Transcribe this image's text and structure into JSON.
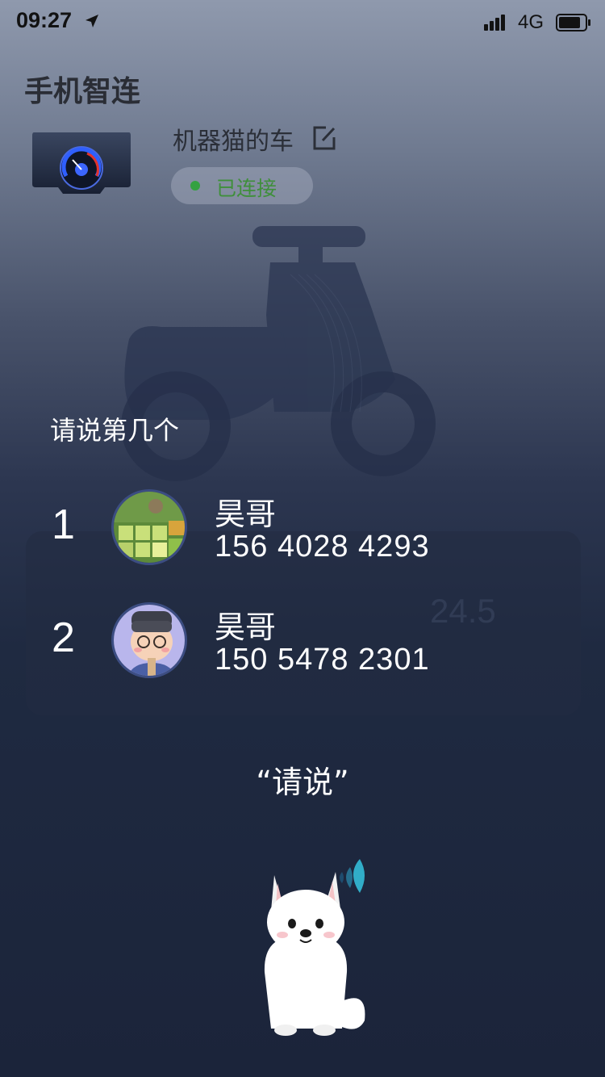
{
  "status_bar": {
    "time": "09:27",
    "network": "4G",
    "icons": [
      "location-arrow-icon",
      "signal-icon",
      "battery-icon"
    ]
  },
  "header": {
    "title": "手机智连"
  },
  "vehicle": {
    "name": "机器猫的车",
    "status": "已连接",
    "status_color": "#34a141",
    "icons": [
      "dashboard-thumbnail",
      "edit-icon"
    ]
  },
  "background_card": {
    "value": "24.5"
  },
  "prompt": "请说第几个",
  "contacts": [
    {
      "index": "1",
      "name": "昊哥",
      "phone": "156 4028 4293",
      "avatar": "game-4096-avatar"
    },
    {
      "index": "2",
      "name": "昊哥",
      "phone": "150 5478 2301",
      "avatar": "cartoon-boy-avatar"
    }
  ],
  "voice_prompt": "“请说”",
  "assistant": {
    "icon": "samoyed-dog-mascot",
    "voice_wave_color": "#35c6e0"
  }
}
